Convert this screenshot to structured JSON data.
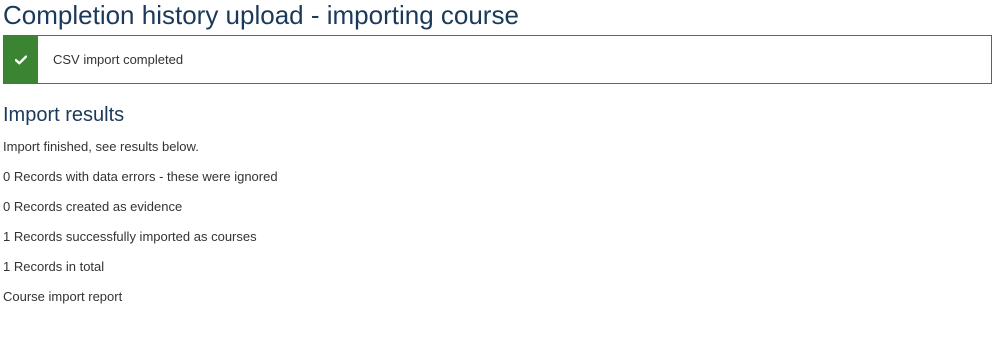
{
  "page": {
    "title": "Completion history upload - importing course"
  },
  "notice": {
    "icon": "check-icon",
    "message": "CSV import completed",
    "accent_color": "#3a8432"
  },
  "results": {
    "heading": "Import results",
    "lines": [
      "Import finished, see results below.",
      "0 Records with data errors - these were ignored",
      "0 Records created as evidence",
      "1 Records successfully imported as courses",
      "1 Records in total",
      "Course import report"
    ]
  }
}
